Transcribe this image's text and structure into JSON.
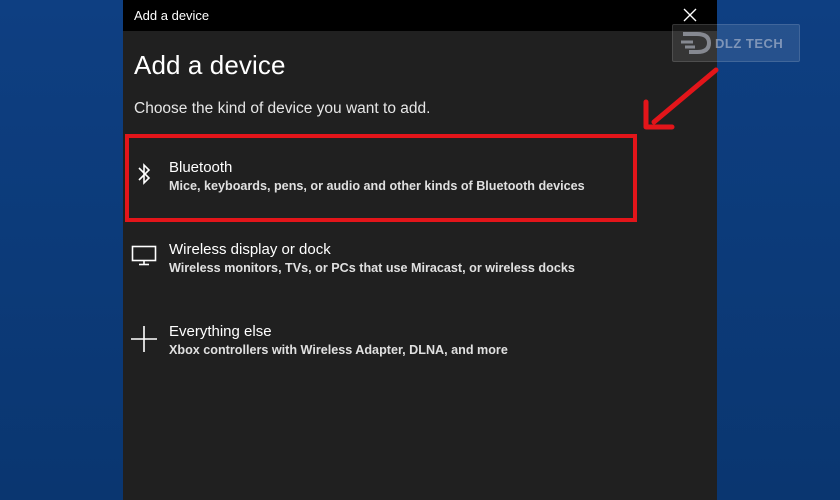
{
  "window": {
    "title": "Add a device"
  },
  "dialog": {
    "heading": "Add a device",
    "subheading": "Choose the kind of device you want to add."
  },
  "options": [
    {
      "icon": "bluetooth-icon",
      "title": "Bluetooth",
      "description": "Mice, keyboards, pens, or audio and other kinds of Bluetooth devices",
      "highlighted": true
    },
    {
      "icon": "monitor-icon",
      "title": "Wireless display or dock",
      "description": "Wireless monitors, TVs, or PCs that use Miracast, or wireless docks",
      "highlighted": false
    },
    {
      "icon": "plus-icon",
      "title": "Everything else",
      "description": "Xbox controllers with Wireless Adapter, DLNA, and more",
      "highlighted": false
    }
  ],
  "watermark": {
    "text": "DLZ TECH"
  },
  "colors": {
    "desktop": "#0c3a7a",
    "dialog_bg": "#202020",
    "titlebar_bg": "#000000",
    "highlight": "#e3151a",
    "arrow": "#e3151a"
  }
}
